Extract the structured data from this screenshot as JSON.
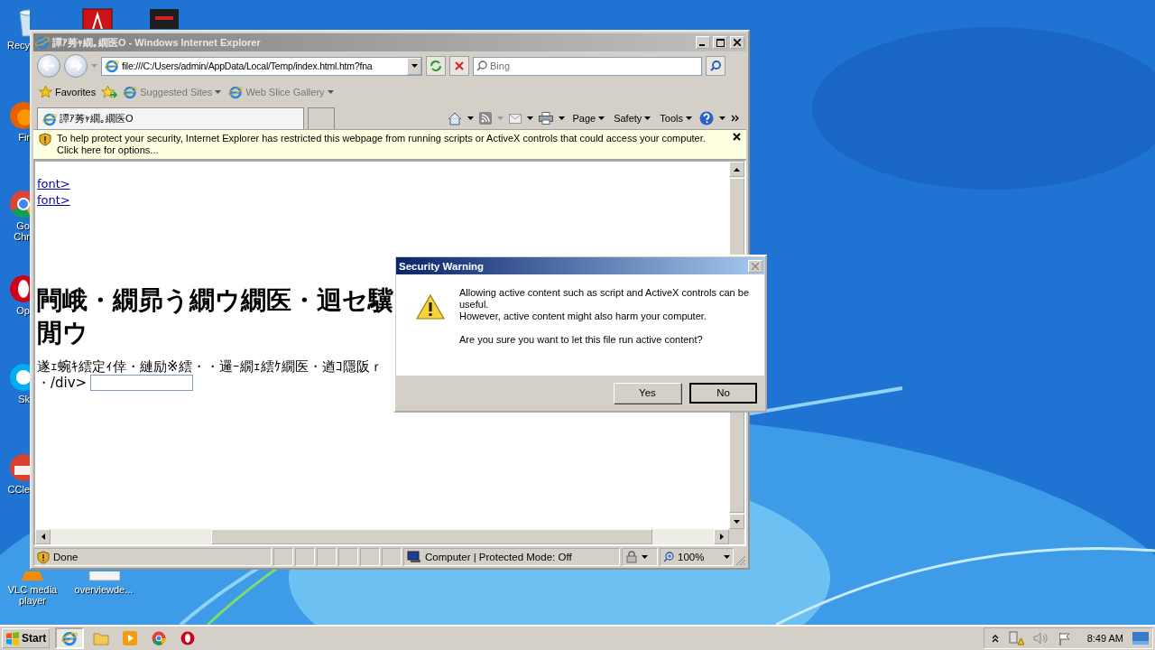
{
  "desktop_icons": [
    {
      "kind": "recycle",
      "label": "Recy"
    },
    {
      "kind": "firefox",
      "label": "Fir"
    },
    {
      "kind": "chrome",
      "label": "Go\nChr"
    },
    {
      "kind": "opera",
      "label": "Op"
    },
    {
      "kind": "skype",
      "label": "Sk"
    },
    {
      "kind": "ccleaner",
      "label": "CCle"
    },
    {
      "kind": "vlc",
      "label": "VLC media player"
    },
    {
      "kind": "document",
      "label": "overviewde..."
    },
    {
      "kind": "acrobat"
    },
    {
      "kind": "app"
    }
  ],
  "browser": {
    "title": "譚ｱ莠ｬ繝｡繝医Ο - Windows Internet Explorer",
    "address": "file:///C:/Users/admin/AppData/Local/Temp/index.html.htm?fna",
    "search": {
      "placeholder": "Bing"
    },
    "favorites": {
      "label": "Favorites",
      "links": [
        "Suggested Sites",
        "Web Slice Gallery"
      ]
    },
    "tabs": [
      {
        "label": "譚ｱ莠ｬ繝｡繝医Ο",
        "selected": true
      }
    ],
    "command_menus": [
      "Page",
      "Safety",
      "Tools"
    ],
    "info_bar": "To help protect your security, Internet Explorer has restricted this webpage from running scripts or ActiveX controls that could access your computer. Click here for options...",
    "page": {
      "links": [
        "font>",
        "font>"
      ],
      "heading_lines": [
        "闁峨・繝昴う繝ウ繝医・迴セ驥",
        "閒ウ"
      ],
      "text": "遂ｪ蜿ｷ繧定ｨ倖・縺励※繧・・邏ｰ繝ｪ繧ｹ繝医・遒ｺ隱阪ｒ",
      "tail": "・/div>"
    },
    "status": {
      "text": "Done",
      "zone": "Computer | Protected Mode: Off",
      "zoom": "100%"
    }
  },
  "dialog": {
    "title": "Security Warning",
    "message": [
      "Allowing active content such as script and ActiveX controls can be useful.",
      "However, active content might also harm your computer."
    ],
    "question": "Are you sure you want to let this file run active content?",
    "buttons": [
      {
        "label": "Yes",
        "default": false
      },
      {
        "label": "No",
        "default": true
      }
    ]
  },
  "taskbar": {
    "start": "Start",
    "apps": [
      {
        "kind": "ie",
        "active": true
      },
      {
        "kind": "explorer",
        "active": false
      },
      {
        "kind": "media",
        "active": false
      },
      {
        "kind": "chrome",
        "active": false
      },
      {
        "kind": "opera",
        "active": false
      }
    ],
    "clock": "8:49 AM"
  }
}
